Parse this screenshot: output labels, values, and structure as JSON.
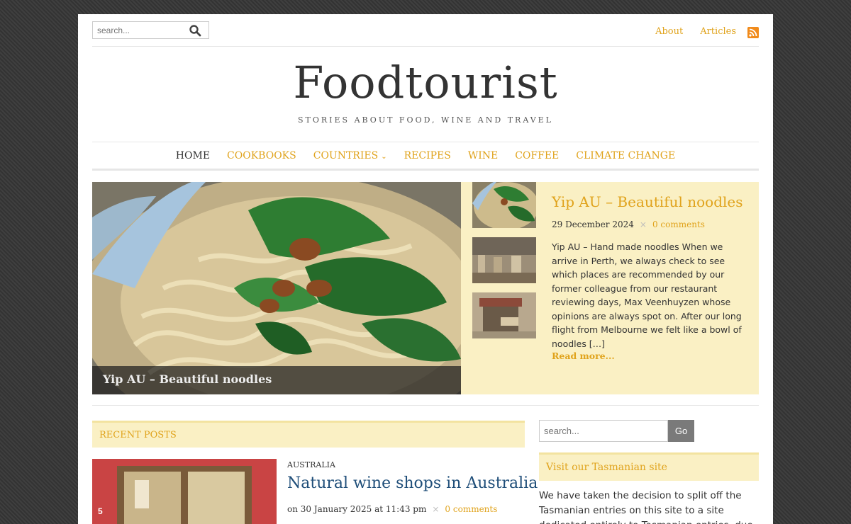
{
  "header": {
    "search_placeholder": "search...",
    "links": [
      "About",
      "Articles"
    ],
    "rss_icon": "rss-icon"
  },
  "site": {
    "title": "Foodtourist",
    "tagline": "STORIES ABOUT FOOD, WINE AND TRAVEL"
  },
  "nav": {
    "items": [
      "HOME",
      "COOKBOOKS",
      "COUNTRIES",
      "RECIPES",
      "WINE",
      "COFFEE",
      "CLIMATE CHANGE"
    ]
  },
  "featured": {
    "caption": "Yip AU – Beautiful noodles",
    "title": "Yip AU – Beautiful noodles",
    "date": "29 December 2024",
    "separator": "×",
    "comments": "0 comments",
    "excerpt": "Yip AU – Hand made noodles When we arrive in Perth, we always check to see which places are recommended by our former colleague from our restaurant reviewing days, Max Veenhuyzen whose opinions are always spot on. After our long flight from Melbourne we felt like a bowl of noodles […]",
    "read_more": "Read more..."
  },
  "recent": {
    "header": "RECENT POSTS",
    "post": {
      "badge": "5",
      "category": "AUSTRALIA",
      "title": "Natural wine shops in Australia",
      "meta": "on 30 January 2025 at 11:43 pm",
      "separator": "×",
      "comments": "0 comments"
    }
  },
  "sidebar": {
    "search_placeholder": "search...",
    "go_label": "Go",
    "widget_title": "Visit our Tasmanian site",
    "widget_text": "We have taken the decision to split off the Tasmanian entries on this site to a site dedicated entirely to Tasmanian entries, due to"
  },
  "colors": {
    "accent": "#e0a31c",
    "highlight_bg": "#faf0c4",
    "link_blue": "#1f4e79"
  }
}
